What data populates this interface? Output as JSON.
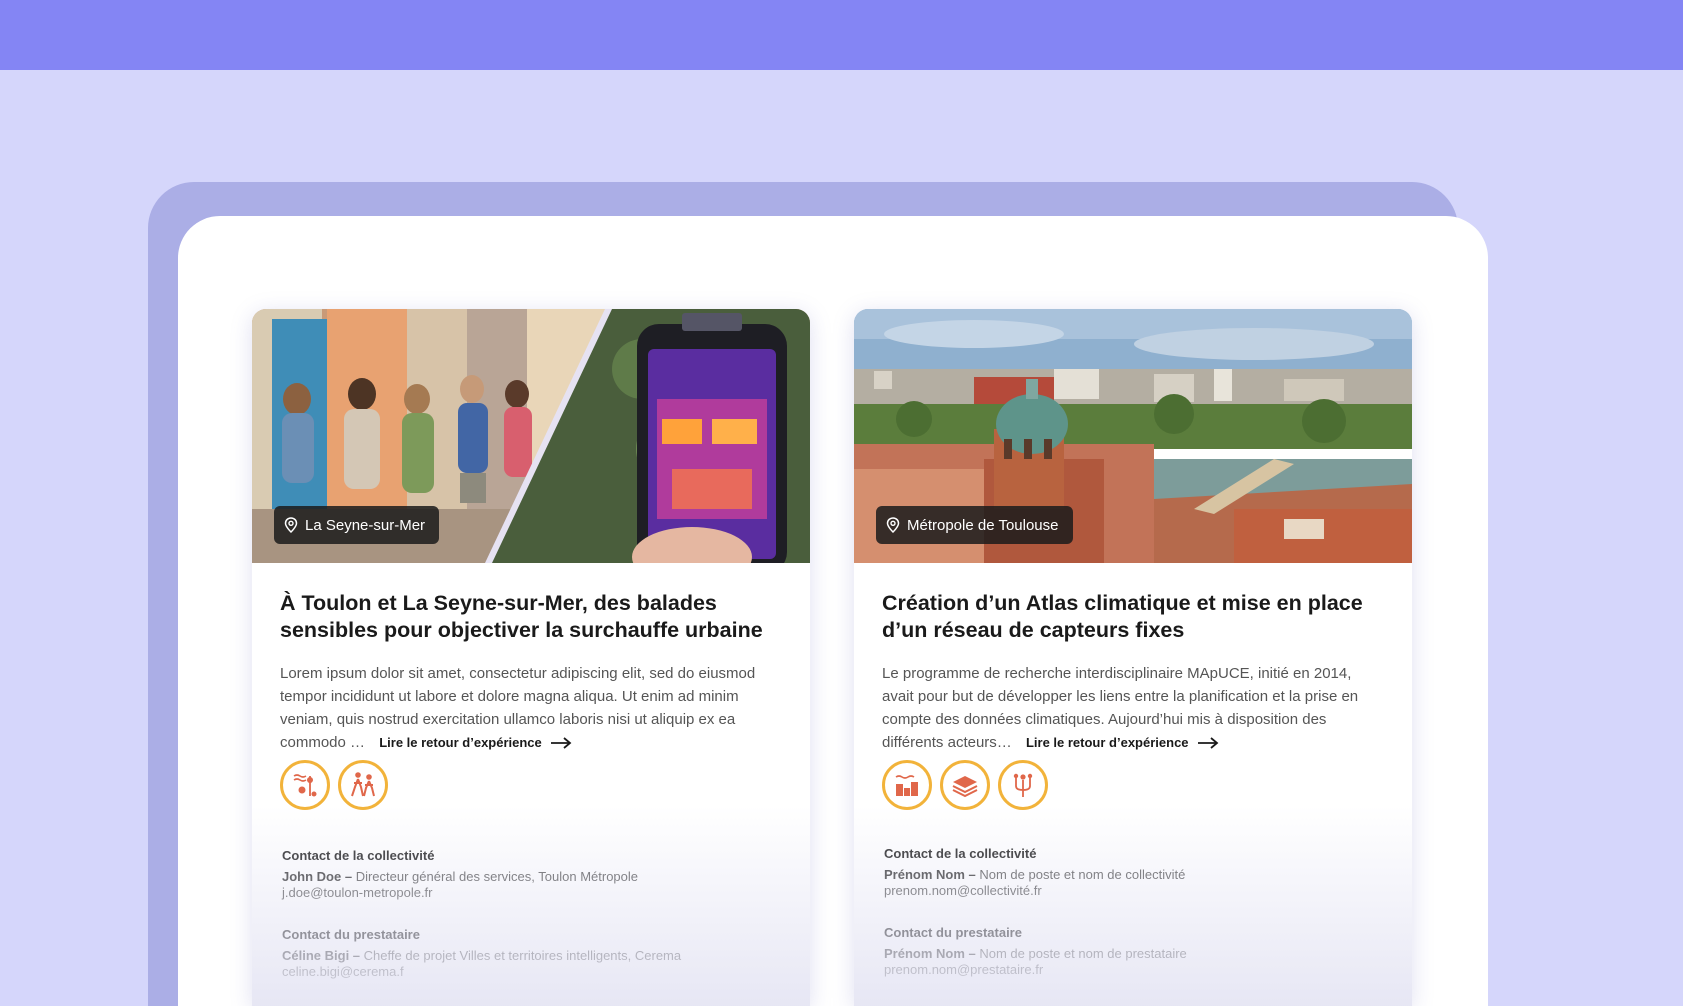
{
  "cards": [
    {
      "location": "La Seyne-sur-Mer",
      "title": "À Toulon et La Seyne-sur-Mer, des balades sensibles pour objectiver la surchauffe urbaine",
      "description": "Lorem ipsum dolor sit amet, consectetur adipiscing elit, sed do eiusmod tempor incididunt ut labore et dolore magna aliqua. Ut enim ad minim veniam, quis nostrud exercitation ullamco laboris nisi ut aliquip ex ea commodo …",
      "link_label": "Lire le retour d’expérience",
      "theme_icons": [
        "heat-island-icon",
        "people-walking-icon"
      ],
      "contact_collectivite": {
        "heading": "Contact de la collectivité",
        "name": "John Doe –",
        "role": "Directeur général des services, Toulon Métropole",
        "email": "j.doe@toulon-metropole.fr"
      },
      "contact_prestataire": {
        "heading": "Contact du prestataire",
        "name": "Céline Bigi –",
        "role": "Cheffe de projet Villes et territoires intelligents, Cerema",
        "email": "celine.bigi@cerema.f"
      }
    },
    {
      "location": "Métropole de Toulouse",
      "title": "Création d’un Atlas climatique et mise en place d’un réseau de capteurs fixes",
      "description": "Le programme de recherche interdisciplinaire MApUCE, initié en 2014, avait pour but de développer les liens entre la planification et la prise en compte des données climatiques. Aujourd’hui mis à disposition des différents acteurs…",
      "link_label": "Lire le retour d’expérience",
      "theme_icons": [
        "city-heat-icon",
        "map-layers-icon",
        "sensor-network-icon"
      ],
      "contact_collectivite": {
        "heading": "Contact de la collectivité",
        "name": "Prénom Nom –",
        "role": "Nom de poste et nom de collectivité",
        "email": "prenom.nom@collectivité.fr"
      },
      "contact_prestataire": {
        "heading": "Contact du prestataire",
        "name": "Prénom Nom –",
        "role": "Nom de poste et nom de prestataire",
        "email": "prenom.nom@prestataire.fr"
      }
    }
  ],
  "colors": {
    "topbar": "#8485f4",
    "page_bg": "#d5d6fb",
    "back_panel": "#abaee6",
    "theme_border": "#f2b33a",
    "theme_glyph": "#e0674a"
  }
}
